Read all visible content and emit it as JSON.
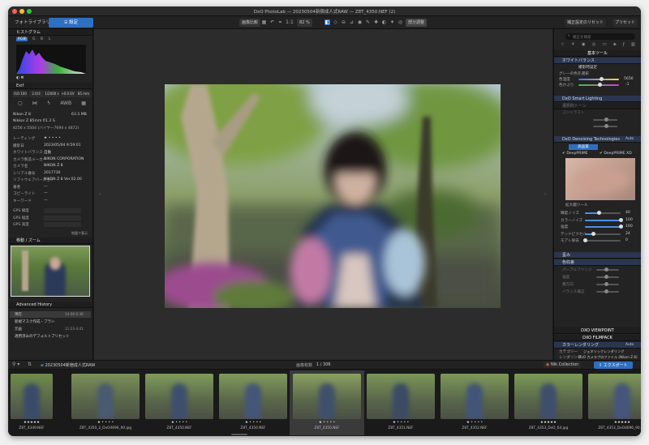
{
  "window": {
    "title": "DxO PhotoLab — 20230504新宿成人式RAW — Z8T_4350.NEF (2)"
  },
  "toolbar": {
    "tab_library": "フォトライブラリ",
    "tab_customize": "設定",
    "compare_label": "画像比較",
    "zoom_fit": "1:1",
    "zoom_pct": "82 %",
    "repair_label": "部分調整",
    "reset_label": "補正設定のリセット",
    "preset_label": "プリセット"
  },
  "left": {
    "histogram_title": "ヒストグラム",
    "hist_tabs": [
      "RGB",
      "R",
      "G",
      "B",
      "L"
    ],
    "exif_title": "Exif",
    "exif_chips": [
      "ISO 100",
      "2.0/3",
      "1/2000 s",
      "+0.0 EV",
      "85 mm"
    ],
    "camera": "Nikon Z 8",
    "filesize": "63.3 MB",
    "lens": "Nikkor Z 85mm f/1.2 S",
    "dims": "8256 x 5504 (バイヤー7694 x 4872)",
    "meta_rows": [
      {
        "k": "レーティング",
        "v": "★ • • • •"
      },
      {
        "k": "撮影日",
        "v": "2023/05/04 9:59:01"
      },
      {
        "k": "ホワイトバランス",
        "v": "自動"
      },
      {
        "k": "カメラ製造メーカー",
        "v": "NIKON CORPORATION"
      },
      {
        "k": "カメラ名",
        "v": "NIKON Z 8"
      },
      {
        "k": "シリアル番号",
        "v": "2017730"
      },
      {
        "k": "ソフトウェアバージョン",
        "v": "NIKON Z 8 Ver.02.00"
      },
      {
        "k": "著者",
        "v": "—"
      },
      {
        "k": "コピーライト",
        "v": "—"
      },
      {
        "k": "キーワード",
        "v": "—"
      }
    ],
    "gps_rows": [
      "GPS 緯度",
      "GPS 経度",
      "GPS 高度"
    ],
    "gps_more": "地図で表示",
    "nav_title": "移動 / ズーム",
    "history_title": "Advanced History",
    "history_items": [
      {
        "label": "現在",
        "time": "14:08 6:36"
      },
      {
        "label": "新規マスク作成・ブラシ",
        "time": ""
      },
      {
        "label": "元画",
        "time": "11:23 4:41"
      },
      {
        "label": "適用済みのデフォルトプリセット",
        "time": ""
      }
    ]
  },
  "right": {
    "search_placeholder": "補正を検索",
    "basic_tools": "基本ツール",
    "wb_title": "ホワイトバランス",
    "wb_mode_label": "撮影時設定",
    "wb_picker_label": "グレーの色を選択",
    "temp_label": "色温度",
    "temp_value": "5656",
    "tint_label": "色かぶり",
    "tint_value": "-1",
    "smart_lighting": "DxO Smart Lighting",
    "selective_tone": "選択的トーン",
    "contrast_label": "コントラスト",
    "denoise_title": "DxO Denoising Technologies",
    "denoise_auto": "Auto",
    "denoise_tab": "高品質",
    "deepprime": "DeepPRIME",
    "deepprimexd": "DeepPRIME XD",
    "preview_label": "拡大鏡ツール",
    "nr_rows": [
      {
        "label": "輝度ノイズ",
        "value": "40"
      },
      {
        "label": "カラーノイズ",
        "value": "100"
      },
      {
        "label": "強度",
        "value": "100"
      },
      {
        "label": "デッドピクセル",
        "value": "24"
      },
      {
        "label": "モアレ除去",
        "value": "0"
      }
    ],
    "lens_title": "歪み",
    "lens_title2": "色収差",
    "lens_rows": [
      "パープルフリンジ",
      "強度",
      "横方向",
      "バランス補正"
    ],
    "viewpoint": "DXO VIEWPOINT",
    "filmpack": "DXO FILMPACK",
    "color_rendering": "カラーレンダリング",
    "color_auto": "Auto",
    "category": "カテゴリー",
    "category_val": "ジェネリックレンダリング",
    "rendering": "レンダリング",
    "rendering_val": "DxO カメラプロファイル (Nikon Z 8)"
  },
  "filmstrip": {
    "folder": "20230504新宿成人式RAW",
    "count_label": "画像枚数",
    "count": "1 / 306",
    "nik_label": "Nik Collection",
    "export_label": "エクスポート",
    "thumbs": [
      {
        "name": "Z8T_4349.NEF",
        "stars": "★★★★★"
      },
      {
        "name": "Z8T_4350_2_DxO4696_90.jpg",
        "stars": "★ • • • •"
      },
      {
        "name": "Z8T_4350.NEF",
        "stars": "★ • • • •"
      },
      {
        "name": "Z8T_4350.NEF",
        "stars": "★ • • • •"
      },
      {
        "name": "Z8T_4350.NEF",
        "stars": "★ • • • •"
      },
      {
        "name": "Z8T_4351.NEF",
        "stars": "★ • • • •"
      },
      {
        "name": "Z8T_4352.NEF",
        "stars": "★ • • • •"
      },
      {
        "name": "Z8T_4353_DxO_64.jpg",
        "stars": "★★★★★"
      },
      {
        "name": "Z8T_4353_DxO4696_90.jpg",
        "stars": "★★★★★"
      }
    ]
  },
  "colors": {
    "accent": "#2f6fc0",
    "panel": "#232323",
    "bg": "#2c2c2c"
  }
}
